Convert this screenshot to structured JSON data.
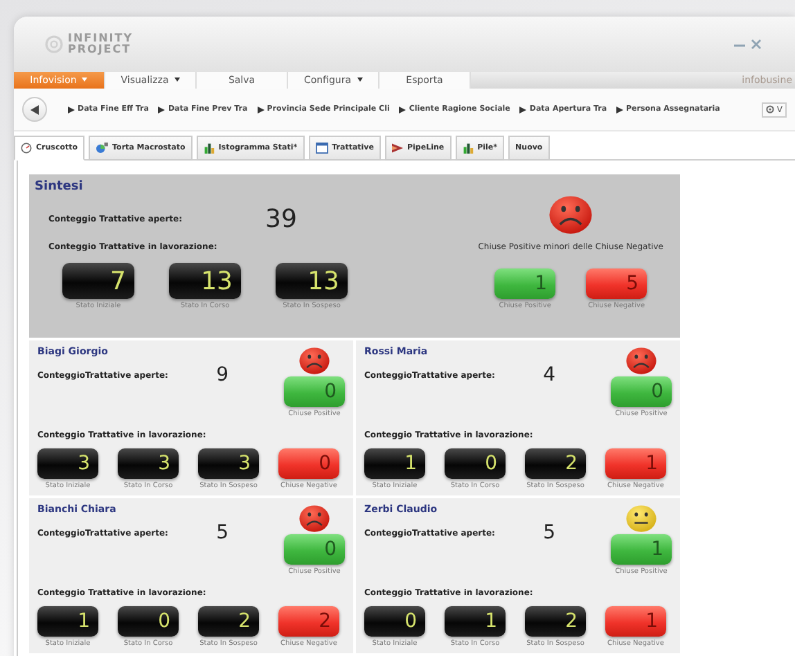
{
  "window": {
    "logo_top": "INFINITY",
    "logo_bottom": "PROJECT"
  },
  "menu": [
    {
      "label": "Infovision",
      "dropdown": true,
      "selected": true
    },
    {
      "label": "Visualizza",
      "dropdown": true,
      "selected": false
    },
    {
      "label": "Salva",
      "dropdown": false,
      "selected": false
    },
    {
      "label": "Configura",
      "dropdown": true,
      "selected": false
    },
    {
      "label": "Esporta",
      "dropdown": false,
      "selected": false
    }
  ],
  "brand": "infobusine",
  "filters": [
    "Data Fine Eff Tra",
    "Data Fine Prev Tra",
    "Provincia Sede Principale Cli",
    "Cliente Ragione Sociale",
    "Data Apertura Tra",
    "Persona Assegnataria"
  ],
  "settings_label": "V",
  "tabs": [
    {
      "label": "Cruscotto",
      "selected": true
    },
    {
      "label": "Torta Macrostato",
      "selected": false
    },
    {
      "label": "Istogramma Stati*",
      "selected": false
    },
    {
      "label": "Trattative",
      "selected": false
    },
    {
      "label": "PipeLine",
      "selected": false
    },
    {
      "label": "Pile*",
      "selected": false
    },
    {
      "label": "Nuovo",
      "selected": false
    }
  ],
  "summary": {
    "title": "Sintesi",
    "open_label": "Conteggio Trattative aperte:",
    "open_count": "39",
    "work_label": "Conteggio Trattative in lavorazione:",
    "face": {
      "kind": "sad"
    },
    "mood_text": "Chiuse Positive minori delle Chiuse Negative",
    "counters": [
      {
        "kind": "dark",
        "value": "7",
        "caption": "Stato Iniziale"
      },
      {
        "kind": "dark",
        "value": "13",
        "caption": "Stato In Corso"
      },
      {
        "kind": "dark",
        "value": "13",
        "caption": "Stato In Sospeso"
      },
      {
        "kind": "green",
        "value": "1",
        "caption": "Chiuse Positive"
      },
      {
        "kind": "red",
        "value": "5",
        "caption": "Chiuse Negative"
      }
    ]
  },
  "people": [
    {
      "name": "Biagi Giorgio",
      "open_label": "ConteggioTrattative aperte:",
      "open_count": "9",
      "work_label": "Conteggio Trattative  in lavorazione:",
      "face": {
        "kind": "sad"
      },
      "counters": [
        {
          "kind": "dark",
          "value": "3",
          "caption": "Stato Iniziale"
        },
        {
          "kind": "dark",
          "value": "3",
          "caption": "Stato In Corso"
        },
        {
          "kind": "dark",
          "value": "3",
          "caption": "Stato In Sospeso"
        },
        {
          "kind": "green",
          "value": "0",
          "caption": "Chiuse Positive"
        },
        {
          "kind": "red",
          "value": "0",
          "caption": "Chiuse Negative"
        }
      ]
    },
    {
      "name": "Rossi Maria",
      "open_label": "ConteggioTrattative aperte:",
      "open_count": "4",
      "work_label": "Conteggio Trattative  in lavorazione:",
      "face": {
        "kind": "sad"
      },
      "counters": [
        {
          "kind": "dark",
          "value": "1",
          "caption": "Stato Iniziale"
        },
        {
          "kind": "dark",
          "value": "0",
          "caption": "Stato In Corso"
        },
        {
          "kind": "dark",
          "value": "2",
          "caption": "Stato In Sospeso"
        },
        {
          "kind": "green",
          "value": "0",
          "caption": "Chiuse Positive"
        },
        {
          "kind": "red",
          "value": "1",
          "caption": "Chiuse Negative"
        }
      ]
    },
    {
      "name": "Bianchi Chiara",
      "open_label": "ConteggioTrattative aperte:",
      "open_count": "5",
      "work_label": "Conteggio Trattative  in lavorazione:",
      "face": {
        "kind": "sad"
      },
      "counters": [
        {
          "kind": "dark",
          "value": "1",
          "caption": "Stato Iniziale"
        },
        {
          "kind": "dark",
          "value": "0",
          "caption": "Stato In Corso"
        },
        {
          "kind": "dark",
          "value": "2",
          "caption": "Stato In Sospeso"
        },
        {
          "kind": "green",
          "value": "0",
          "caption": "Chiuse Positive"
        },
        {
          "kind": "red",
          "value": "2",
          "caption": "Chiuse Negative"
        }
      ]
    },
    {
      "name": "Zerbi Claudio",
      "open_label": "ConteggioTrattative aperte:",
      "open_count": "5",
      "work_label": "Conteggio Trattative  in lavorazione:",
      "face": {
        "kind": "neutral"
      },
      "counters": [
        {
          "kind": "dark",
          "value": "0",
          "caption": "Stato Iniziale"
        },
        {
          "kind": "dark",
          "value": "1",
          "caption": "Stato In Corso"
        },
        {
          "kind": "dark",
          "value": "2",
          "caption": "Stato In Sospeso"
        },
        {
          "kind": "green",
          "value": "1",
          "caption": "Chiuse Positive"
        },
        {
          "kind": "red",
          "value": "1",
          "caption": "Chiuse Negative"
        }
      ]
    }
  ]
}
